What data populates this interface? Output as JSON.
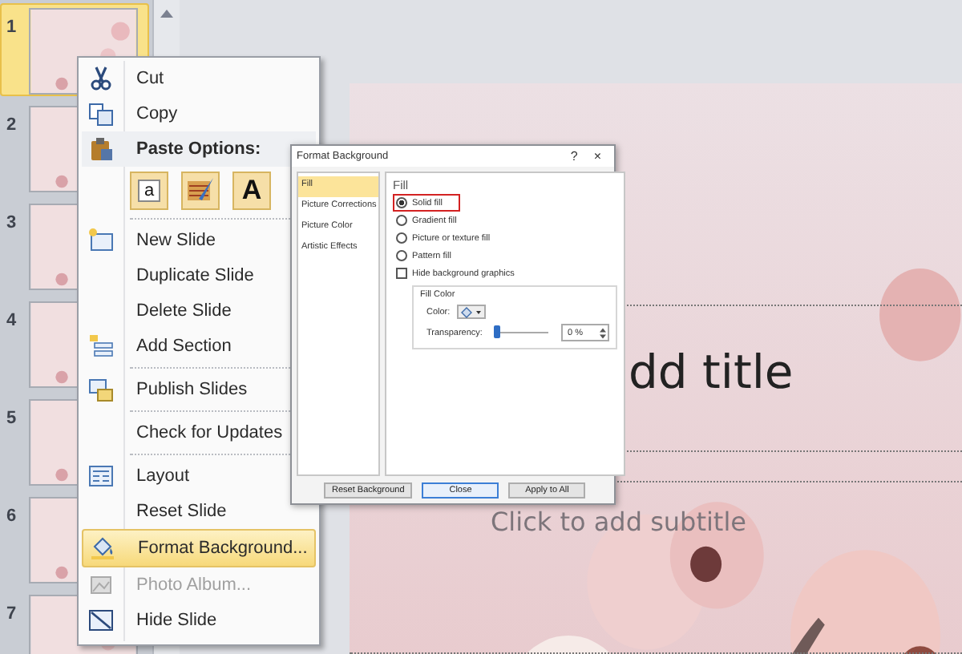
{
  "thumbnails": [
    {
      "number": "1",
      "selected": true
    },
    {
      "number": "2",
      "selected": false
    },
    {
      "number": "3",
      "selected": false
    },
    {
      "number": "4",
      "selected": false
    },
    {
      "number": "5",
      "selected": false
    },
    {
      "number": "6",
      "selected": false
    },
    {
      "number": "7",
      "selected": false
    }
  ],
  "slide": {
    "title": "dd title",
    "subtitle": "Click to add subtitle"
  },
  "context_menu": {
    "items": [
      {
        "kind": "item",
        "label": "Cut",
        "selected": false,
        "disabled": false
      },
      {
        "kind": "item",
        "label": "Copy",
        "selected": false,
        "disabled": false
      },
      {
        "kind": "header",
        "label": "Paste Options:"
      },
      {
        "kind": "paste",
        "options": [
          {
            "kind": "keep_text",
            "glyph": "a"
          },
          {
            "kind": "merge"
          },
          {
            "kind": "text_only",
            "glyph": "A"
          }
        ]
      },
      {
        "kind": "separator"
      },
      {
        "kind": "item",
        "label": "New Slide",
        "selected": false,
        "disabled": false
      },
      {
        "kind": "item",
        "label": "Duplicate Slide",
        "selected": false,
        "disabled": false
      },
      {
        "kind": "item",
        "label": "Delete Slide",
        "selected": false,
        "disabled": false
      },
      {
        "kind": "item",
        "label": "Add Section",
        "selected": false,
        "disabled": false
      },
      {
        "kind": "separator"
      },
      {
        "kind": "item",
        "label": "Publish Slides",
        "selected": false,
        "disabled": false
      },
      {
        "kind": "separator"
      },
      {
        "kind": "item",
        "label": "Check for Updates",
        "selected": false,
        "disabled": false
      },
      {
        "kind": "separator"
      },
      {
        "kind": "item",
        "label": "Layout",
        "selected": false,
        "disabled": false
      },
      {
        "kind": "item",
        "label": "Reset Slide",
        "selected": false,
        "disabled": false
      },
      {
        "kind": "item",
        "label": "Format Background...",
        "selected": true,
        "disabled": false
      },
      {
        "kind": "item",
        "label": "Photo Album...",
        "selected": false,
        "disabled": true
      },
      {
        "kind": "item",
        "label": "Hide Slide",
        "selected": false,
        "disabled": false
      }
    ]
  },
  "dialog": {
    "title": "Format Background",
    "help": "?",
    "close": "×",
    "nav": [
      {
        "label": "Fill",
        "selected": true
      },
      {
        "label": "Picture Corrections",
        "selected": false
      },
      {
        "label": "Picture Color",
        "selected": false
      },
      {
        "label": "Artistic Effects",
        "selected": false
      }
    ],
    "heading": "Fill",
    "fill_options": [
      {
        "label": "Solid fill",
        "selected": true,
        "annotated": true
      },
      {
        "label": "Gradient fill",
        "selected": false,
        "annotated": false
      },
      {
        "label": "Picture or texture fill",
        "selected": false,
        "annotated": false
      },
      {
        "label": "Pattern fill",
        "selected": false,
        "annotated": false
      }
    ],
    "hide_background_graphics": {
      "label": "Hide background graphics",
      "checked": false
    },
    "fill_color": {
      "title": "Fill Color",
      "color_label": "Color:",
      "transparency_label": "Transparency:",
      "transparency": {
        "level": 0
      },
      "transparency_value": "0 %"
    },
    "buttons": [
      {
        "label": "Reset Background",
        "default": false
      },
      {
        "label": "Close",
        "default": true
      },
      {
        "label": "Apply to All",
        "default": false
      }
    ]
  }
}
